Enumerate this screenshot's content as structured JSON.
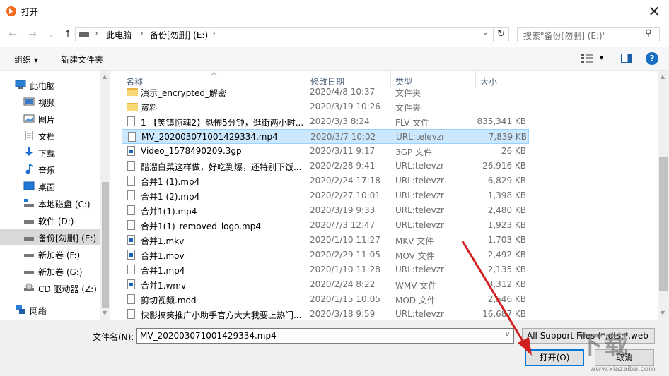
{
  "window": {
    "title": "打开",
    "close_glyph": "✕"
  },
  "navigation": {
    "back_glyph": "←",
    "forward_glyph": "→",
    "dropdown_glyph": "⌄",
    "up_glyph": "↑",
    "address": [
      "此电脑",
      "备份[勿删] (E:)"
    ],
    "refresh_glyph": "↻",
    "search_placeholder": "搜索\"备份[勿删] (E:)\"",
    "search_glyph": "⚲"
  },
  "toolbar": {
    "organize_label": "组织 ▾",
    "new_folder_label": "新建文件夹"
  },
  "sidebar": {
    "items": [
      {
        "label": "此电脑",
        "icon": "computer-icon"
      },
      {
        "label": "视频",
        "icon": "video-folder-icon"
      },
      {
        "label": "图片",
        "icon": "pictures-folder-icon"
      },
      {
        "label": "文档",
        "icon": "documents-folder-icon"
      },
      {
        "label": "下载",
        "icon": "download-icon"
      },
      {
        "label": "音乐",
        "icon": "music-icon"
      },
      {
        "label": "桌面",
        "icon": "desktop-icon"
      },
      {
        "label": "本地磁盘 (C:)",
        "icon": "drive-icon"
      },
      {
        "label": "软件 (D:)",
        "icon": "drive-icon"
      },
      {
        "label": "备份[勿删] (E:)",
        "icon": "drive-icon",
        "selected": true
      },
      {
        "label": "新加卷 (F:)",
        "icon": "drive-icon"
      },
      {
        "label": "新加卷 (G:)",
        "icon": "drive-icon"
      },
      {
        "label": "CD 驱动器 (Z:)",
        "icon": "cd-drive-icon"
      },
      {
        "label": "网络",
        "icon": "network-icon"
      }
    ]
  },
  "columns": {
    "name": "名称",
    "date": "修改日期",
    "type": "类型",
    "size": "大小"
  },
  "files": [
    {
      "name": "演示_encrypted_解密",
      "date": "2020/4/8 10:37",
      "type": "文件夹",
      "size": "",
      "icon": "folder"
    },
    {
      "name": "资料",
      "date": "2020/3/19 10:26",
      "type": "文件夹",
      "size": "",
      "icon": "folder"
    },
    {
      "name": "1 【笑镇惊魂2】恐怖5分钟，逛街两小时...",
      "date": "2020/3/3 8:24",
      "type": "FLV 文件",
      "size": "835,341 KB",
      "icon": "file"
    },
    {
      "name": "MV_20200307100142933​4.mp4",
      "date": "2020/3/7 10:02",
      "type": "URL:televzr",
      "size": "7,839 KB",
      "icon": "file",
      "selected": true
    },
    {
      "name": "Video_1578490209.3gp",
      "date": "2020/3/11 9:17",
      "type": "3GP 文件",
      "size": "26 KB",
      "icon": "media"
    },
    {
      "name": "醋溜白菜这样做，好吃到爆，还特别下饭...",
      "date": "2020/2/28 9:41",
      "type": "URL:televzr",
      "size": "26,916 KB",
      "icon": "file"
    },
    {
      "name": "合并1 (1).mp4",
      "date": "2020/2/24 17:18",
      "type": "URL:televzr",
      "size": "6,829 KB",
      "icon": "file"
    },
    {
      "name": "合并1 (2).mp4",
      "date": "2020/2/27 10:01",
      "type": "URL:televzr",
      "size": "1,398 KB",
      "icon": "file"
    },
    {
      "name": "合并1(1).mp4",
      "date": "2020/3/19 9:33",
      "type": "URL:televzr",
      "size": "2,480 KB",
      "icon": "file"
    },
    {
      "name": "合并1(1)_removed_logo.mp4",
      "date": "2020/7/3 12:47",
      "type": "URL:televzr",
      "size": "1,923 KB",
      "icon": "file"
    },
    {
      "name": "合并1.mkv",
      "date": "2020/1/10 11:27",
      "type": "MKV 文件",
      "size": "1,703 KB",
      "icon": "media"
    },
    {
      "name": "合并1.mov",
      "date": "2020/2/29 11:05",
      "type": "MOV 文件",
      "size": "2,492 KB",
      "icon": "media"
    },
    {
      "name": "合并1.mp4",
      "date": "2020/1/10 11:28",
      "type": "URL:televzr",
      "size": "2,135 KB",
      "icon": "file"
    },
    {
      "name": "合并1.wmv",
      "date": "2020/2/24 8:22",
      "type": "WMV 文件",
      "size": "3,312 KB",
      "icon": "media"
    },
    {
      "name": "剪切视频.mod",
      "date": "2020/1/15 10:05",
      "type": "MOD 文件",
      "size": "2,546 KB",
      "icon": "file"
    },
    {
      "name": "快影搞笑推广小助手官方大大我要上热门...",
      "date": "2020/3/18 9:59",
      "type": "URL:televzr",
      "size": "16,687 KB",
      "icon": "file"
    }
  ],
  "footer": {
    "filename_label": "文件名(N):",
    "filename_value": "MV_202003071001429334.mp4",
    "filter_value": "All Support Files (*.dts;*.web",
    "open_label": "打开(O)",
    "cancel_label": "取消"
  },
  "watermark": {
    "text": "下载",
    "sub": "www.xiazaiba.com"
  },
  "colors": {
    "selection": "#cce8ff",
    "accent": "#0078d7",
    "arrow": "#d11e1e"
  }
}
